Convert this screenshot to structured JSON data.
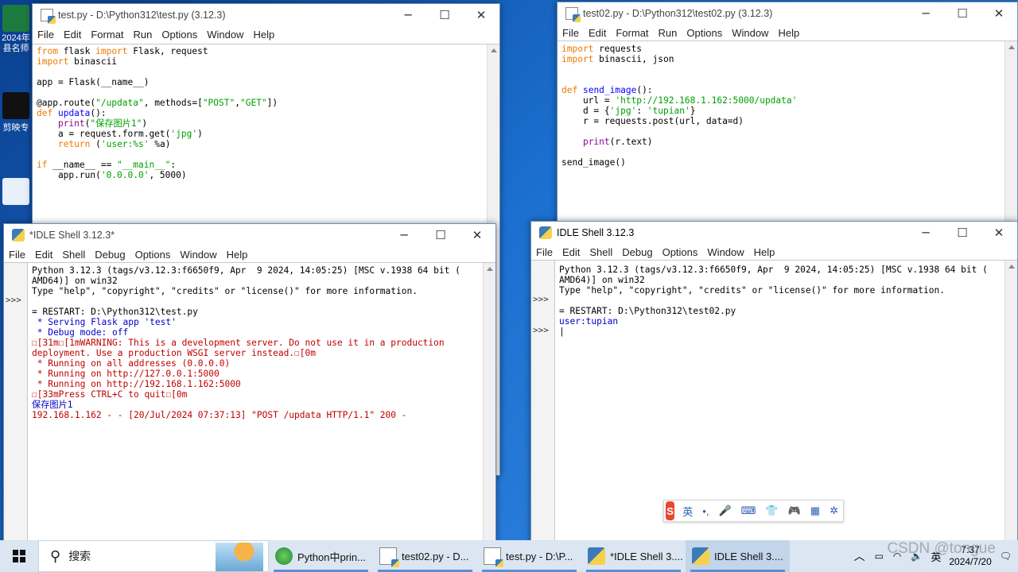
{
  "desktop": {
    "icons": [
      {
        "label": "2024年\n县名师",
        "icon": "excel-icon"
      },
      {
        "label": "剪映专",
        "icon": "capcut-icon"
      },
      {
        "label": "",
        "icon": "app-icon"
      }
    ]
  },
  "editor1": {
    "title": "test.py - D:\\Python312\\test.py (3.12.3)",
    "menu": [
      "File",
      "Edit",
      "Format",
      "Run",
      "Options",
      "Window",
      "Help"
    ]
  },
  "editor2": {
    "title": "test02.py - D:\\Python312\\test02.py (3.12.3)",
    "menu": [
      "File",
      "Edit",
      "Format",
      "Run",
      "Options",
      "Window",
      "Help"
    ]
  },
  "shell1": {
    "title": "*IDLE Shell 3.12.3*",
    "menu": [
      "File",
      "Edit",
      "Shell",
      "Debug",
      "Options",
      "Window",
      "Help"
    ],
    "prompts": [
      ">>>"
    ]
  },
  "shell2": {
    "title": "IDLE Shell 3.12.3",
    "menu": [
      "File",
      "Edit",
      "Shell",
      "Debug",
      "Options",
      "Window",
      "Help"
    ],
    "prompts": [
      ">>>",
      ">>>"
    ]
  },
  "ime_toolbar": {
    "mode": "英",
    "punct": "•,"
  },
  "taskbar": {
    "search_placeholder": "搜索",
    "apps": [
      {
        "label": "Python中prin...",
        "icon": "edge-icon",
        "active": false
      },
      {
        "label": "test02.py - D...",
        "icon": "python-file-icon",
        "active": false
      },
      {
        "label": "test.py - D:\\P...",
        "icon": "python-file-icon",
        "active": false
      },
      {
        "label": "*IDLE Shell 3....",
        "icon": "python-idle-icon",
        "active": false
      },
      {
        "label": "IDLE Shell 3....",
        "icon": "python-idle-icon",
        "active": true
      }
    ],
    "ime": "英",
    "clock_time": "7:37",
    "clock_date": "2024/7/20",
    "watermark": "CSDN @tongue"
  }
}
